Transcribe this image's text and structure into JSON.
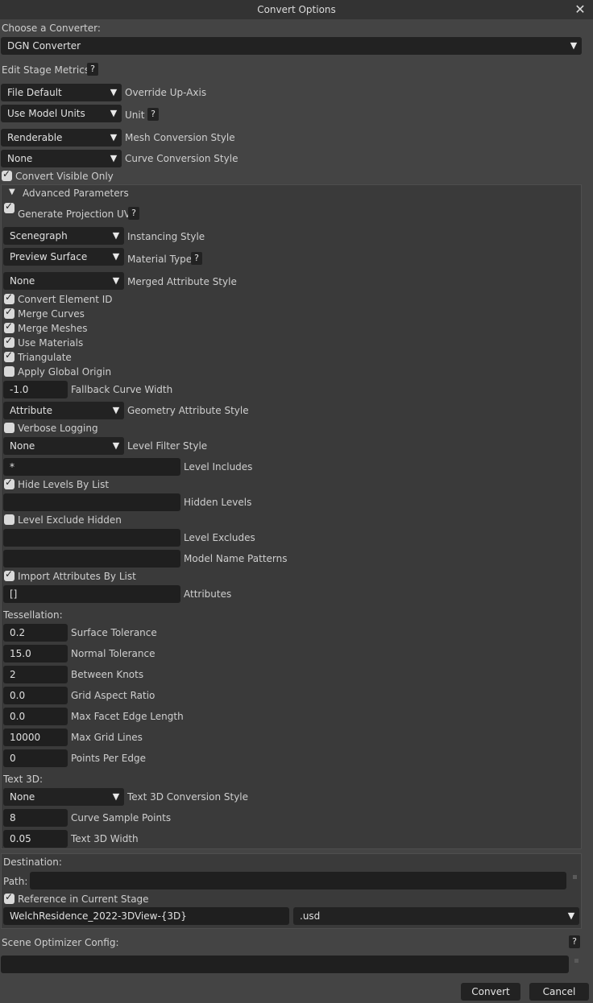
{
  "window": {
    "title": "Convert Options",
    "close_glyph": "✕"
  },
  "converter": {
    "label": "Choose a Converter:",
    "value": "DGN Converter"
  },
  "stage_metrics": {
    "label": "Edit Stage Metrics:",
    "help": "?"
  },
  "top_rows": [
    {
      "value": "File Default",
      "label": "Override Up-Axis"
    },
    {
      "value": "Use Model Units",
      "label": "Unit"
    },
    {
      "value": "Renderable",
      "label": "Mesh Conversion Style"
    },
    {
      "value": "None",
      "label": "Curve Conversion Style"
    }
  ],
  "unit_help": "?",
  "convert_visible_only": {
    "label": "Convert Visible Only",
    "checked": true
  },
  "advanced": {
    "header": "Advanced Parameters",
    "gen_uv": {
      "label": "Generate Projection UVs",
      "checked": true,
      "help": "?"
    },
    "instancing": {
      "value": "Scenegraph",
      "label": "Instancing Style"
    },
    "material": {
      "value": "Preview Surface",
      "label": "Material Type",
      "help": "?"
    },
    "merged_attr": {
      "value": "None",
      "label": "Merged Attribute Style"
    },
    "checks": [
      {
        "label": "Convert Element ID",
        "checked": true
      },
      {
        "label": "Merge Curves",
        "checked": true
      },
      {
        "label": "Merge Meshes",
        "checked": true
      },
      {
        "label": "Use Materials",
        "checked": true
      },
      {
        "label": "Triangulate",
        "checked": true
      },
      {
        "label": "Apply Global Origin",
        "checked": false
      }
    ],
    "fallback_curve_width": {
      "value": "-1.0",
      "label": "Fallback Curve Width"
    },
    "geometry_attr": {
      "value": "Attribute",
      "label": "Geometry Attribute Style"
    },
    "verbose": {
      "label": "Verbose Logging",
      "checked": false
    },
    "level_filter": {
      "value": "None",
      "label": "Level Filter Style"
    },
    "level_includes": {
      "value": "*",
      "label": "Level Includes"
    },
    "hide_levels": {
      "label": "Hide Levels By List",
      "checked": true
    },
    "hidden_levels": {
      "value": "",
      "label": "Hidden Levels"
    },
    "level_exclude_hidden": {
      "label": "Level Exclude Hidden",
      "checked": false
    },
    "level_excludes": {
      "value": "",
      "label": "Level Excludes"
    },
    "model_name_patterns": {
      "value": "",
      "label": "Model Name Patterns"
    },
    "import_attrs": {
      "label": "Import Attributes By List",
      "checked": true
    },
    "attributes": {
      "value": "[]",
      "label": "Attributes"
    },
    "tessellation": {
      "header": "Tessellation:",
      "rows": [
        {
          "value": "0.2",
          "label": "Surface Tolerance"
        },
        {
          "value": "15.0",
          "label": "Normal Tolerance"
        },
        {
          "value": "2",
          "label": "Between Knots"
        },
        {
          "value": "0.0",
          "label": "Grid Aspect Ratio"
        },
        {
          "value": "0.0",
          "label": "Max Facet Edge Length"
        },
        {
          "value": "10000",
          "label": "Max Grid Lines"
        },
        {
          "value": "0",
          "label": "Points Per Edge"
        }
      ]
    },
    "text3d": {
      "header": "Text 3D:",
      "style": {
        "value": "None",
        "label": "Text 3D Conversion Style"
      },
      "sample_points": {
        "value": "8",
        "label": "Curve Sample Points"
      },
      "width": {
        "value": "0.05",
        "label": "Text 3D Width"
      }
    }
  },
  "destination": {
    "header": "Destination:",
    "path_label": "Path:",
    "path_value": "",
    "reference": {
      "label": "Reference in Current Stage",
      "checked": true
    },
    "filename": "WelchResidence_2022-3DView-{3D}",
    "extension": ".usd"
  },
  "optimizer": {
    "label": "Scene Optimizer Config:",
    "help": "?",
    "value": ""
  },
  "buttons": {
    "convert": "Convert",
    "cancel": "Cancel"
  },
  "icons": {
    "dropdown": "▼",
    "expanded": "▼"
  }
}
